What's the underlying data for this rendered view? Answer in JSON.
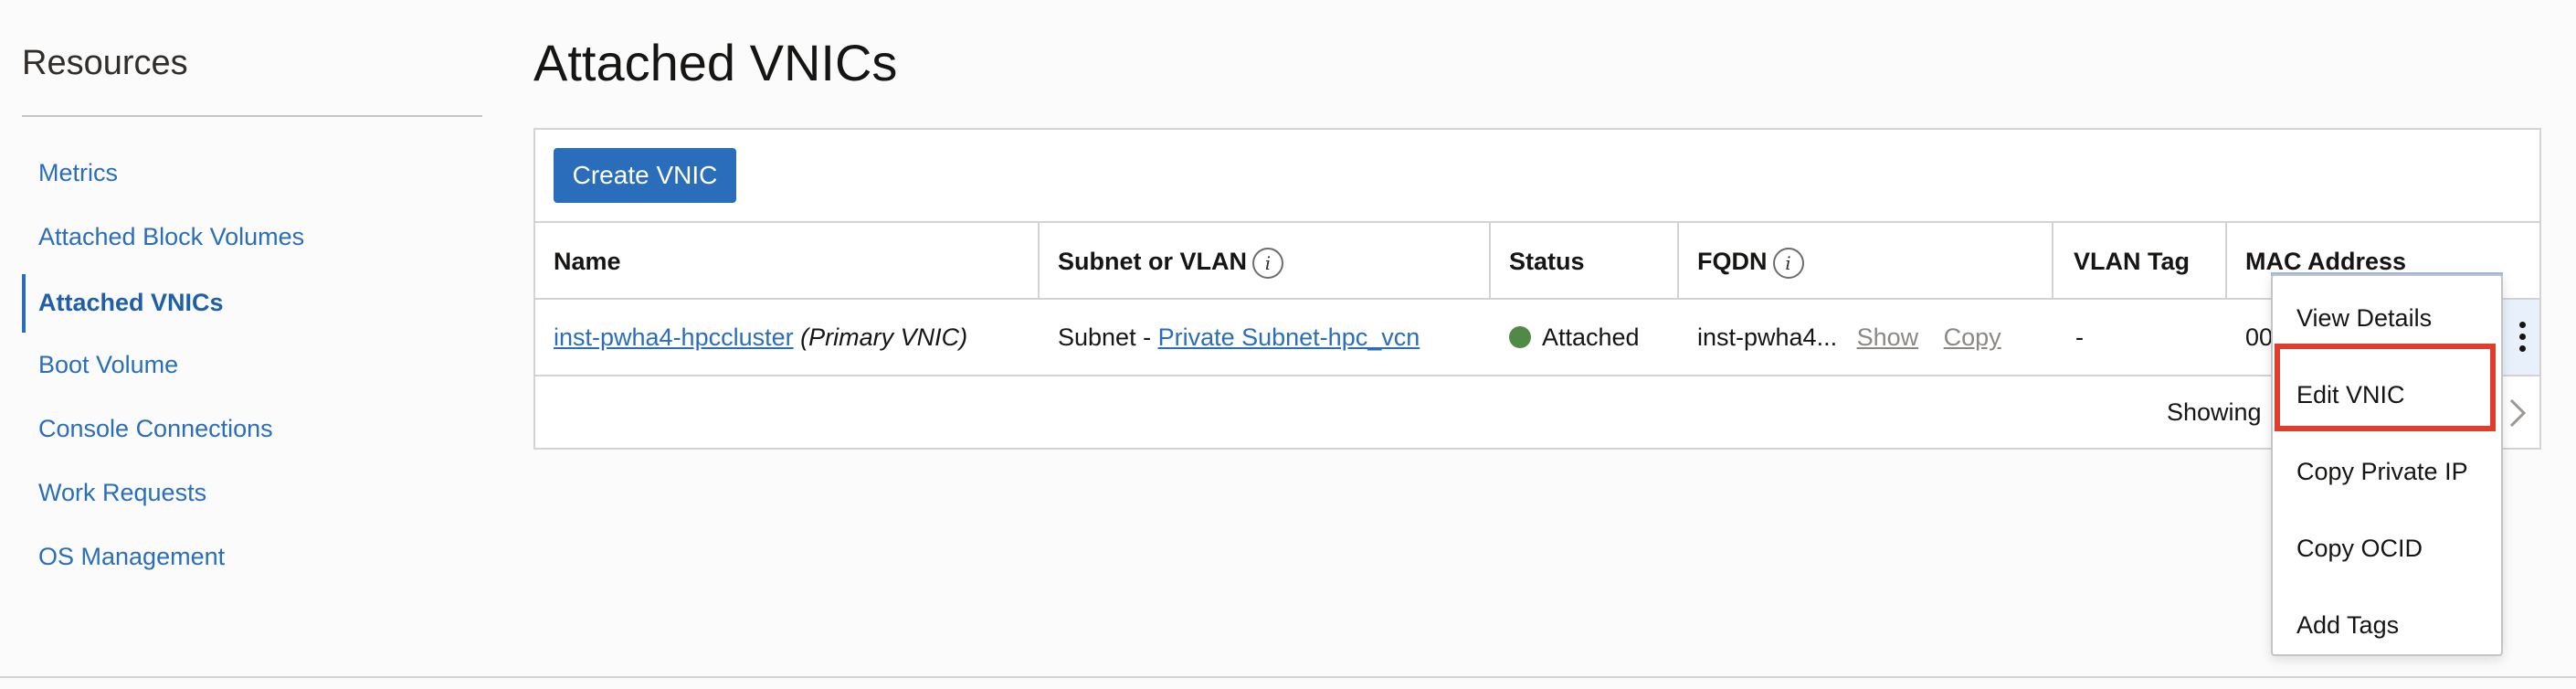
{
  "sidebar": {
    "title": "Resources",
    "items": [
      {
        "label": "Metrics"
      },
      {
        "label": "Attached Block Volumes"
      },
      {
        "label": "Attached VNICs",
        "active": true
      },
      {
        "label": "Boot Volume"
      },
      {
        "label": "Console Connections"
      },
      {
        "label": "Work Requests"
      },
      {
        "label": "OS Management"
      }
    ]
  },
  "main": {
    "title": "Attached VNICs",
    "create_button": "Create VNIC",
    "columns": [
      "Name",
      "Subnet or VLAN",
      "Status",
      "FQDN",
      "VLAN Tag",
      "MAC Address"
    ],
    "row": {
      "name_link": "inst-pwha4-hpccluster",
      "name_suffix": "(Primary VNIC)",
      "subnet_prefix": "Subnet - ",
      "subnet_link": "Private Subnet-hpc_vcn",
      "status": "Attached",
      "fqdn": "inst-pwha4...",
      "fqdn_show": "Show",
      "fqdn_copy": "Copy",
      "vlan_tag": "-",
      "mac_partial": "00"
    },
    "footer_text": "Showing"
  },
  "context_menu": {
    "items": [
      "View Details",
      "Edit VNIC",
      "Copy Private IP",
      "Copy OCID",
      "Add Tags"
    ],
    "highlighted": "Edit VNIC"
  },
  "colors": {
    "link": "#2a6ebb",
    "button": "#2a6ebb",
    "status_attached": "#508a46",
    "highlight_box": "#e03e2d"
  },
  "icons": [
    "info-icon",
    "status-dot-icon",
    "kebab-menu-icon",
    "chevron-right-icon"
  ]
}
